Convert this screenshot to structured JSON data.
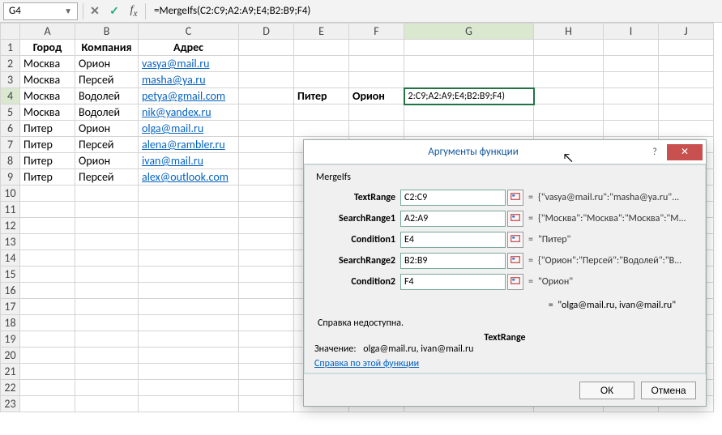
{
  "namebox": "G4",
  "formula": "=MergeIfs(C2:C9;A2:A9;E4;B2:B9;F4)",
  "columns": [
    "A",
    "B",
    "C",
    "D",
    "E",
    "F",
    "G",
    "H",
    "I",
    "J"
  ],
  "headers": {
    "A": "Город",
    "B": "Компания",
    "C": "Адрес"
  },
  "rows": [
    {
      "A": "Москва",
      "B": "Орион",
      "C": "vasya@mail.ru"
    },
    {
      "A": "Москва",
      "B": "Персей",
      "C": "masha@ya.ru"
    },
    {
      "A": "Москва",
      "B": "Водолей",
      "C": "petya@gmail.com",
      "E": "Питер",
      "F": "Орион",
      "G": "2:C9;A2:A9;E4;B2:B9;F4)"
    },
    {
      "A": "Москва",
      "B": "Водолей",
      "C": "nik@yandex.ru"
    },
    {
      "A": "Питер",
      "B": "Орион",
      "C": "olga@mail.ru"
    },
    {
      "A": "Питер",
      "B": "Персей",
      "C": "alena@rambler.ru"
    },
    {
      "A": "Питер",
      "B": "Орион",
      "C": "ivan@mail.ru"
    },
    {
      "A": "Питер",
      "B": "Персей",
      "C": "alex@outlook.com"
    }
  ],
  "dialog": {
    "title": "Аргументы функции",
    "fn": "MergeIfs",
    "args": [
      {
        "label": "TextRange",
        "value": "C2:C9",
        "eval": "{\"vasya@mail.ru\":\"masha@ya.ru\"..."
      },
      {
        "label": "SearchRange1",
        "value": "A2:A9",
        "eval": "{\"Москва\":\"Москва\":\"Москва\":\"М..."
      },
      {
        "label": "Condition1",
        "value": "E4",
        "eval": "\"Питер\""
      },
      {
        "label": "SearchRange2",
        "value": "B2:B9",
        "eval": "{\"Орион\":\"Персей\":\"Водолей\":\"В..."
      },
      {
        "label": "Condition2",
        "value": "F4",
        "eval": "\"Орион\""
      }
    ],
    "result_eval": "\"olga@mail.ru, ivan@mail.ru\"",
    "help_unavailable": "Справка недоступна.",
    "current_arg": "TextRange",
    "value_label": "Значение:",
    "value": "olga@mail.ru, ivan@mail.ru",
    "help_link": "Справка по этой функции",
    "ok": "ОК",
    "cancel": "Отмена"
  }
}
